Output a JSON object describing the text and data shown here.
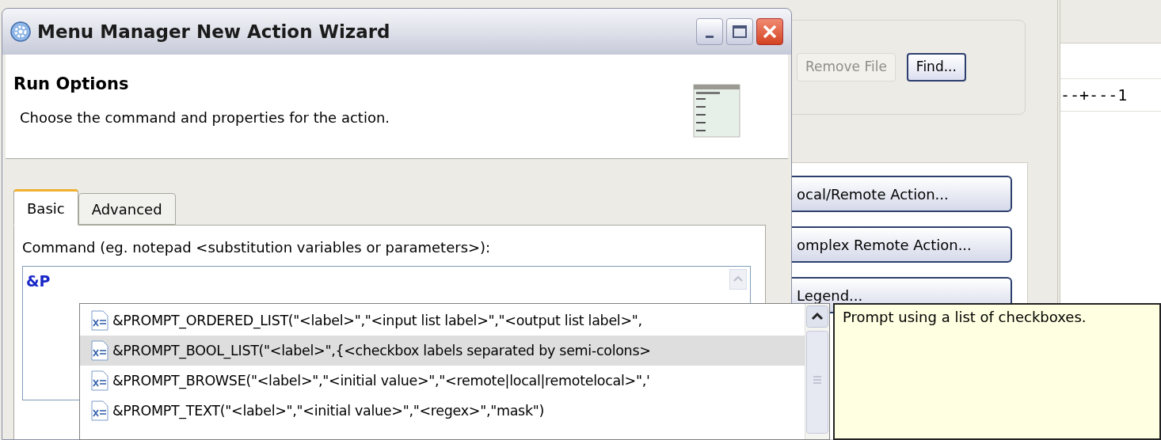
{
  "background": {
    "remove_file_button": {
      "label": "Remove File",
      "disabled": true
    },
    "find_button": {
      "label": "Find..."
    },
    "action_buttons": [
      "ocal/Remote Action...",
      "omplex Remote Action...",
      "Legend..."
    ],
    "ruler": "--+---1"
  },
  "window": {
    "title": "Menu Manager New Action Wizard"
  },
  "header": {
    "title": "Run Options",
    "description": "Choose the command and properties for the action."
  },
  "tabs": [
    {
      "label": "Basic",
      "selected": true
    },
    {
      "label": "Advanced",
      "selected": false
    }
  ],
  "command": {
    "label": "Command (eg. notepad <substitution variables or parameters>):",
    "value": "&P"
  },
  "completions": [
    {
      "kind": "variable",
      "label": "&PROMPT_ORDERED_LIST(\"<label>\",\"<input list label>\",\"<output list label>\",",
      "selected": false
    },
    {
      "kind": "variable",
      "label": "&PROMPT_BOOL_LIST(\"<label>\",{<checkbox labels separated by semi-colons>",
      "selected": true
    },
    {
      "kind": "variable",
      "label": "&PROMPT_BROWSE(\"<label>\",\"<initial value>\",\"<remote|local|remotelocal>\",'",
      "selected": false
    },
    {
      "kind": "variable",
      "label": "&PROMPT_TEXT(\"<label>\",\"<initial value>\",\"<regex>\",\"mask\")",
      "selected": false
    }
  ],
  "tooltip": "Prompt using a list of checkboxes."
}
